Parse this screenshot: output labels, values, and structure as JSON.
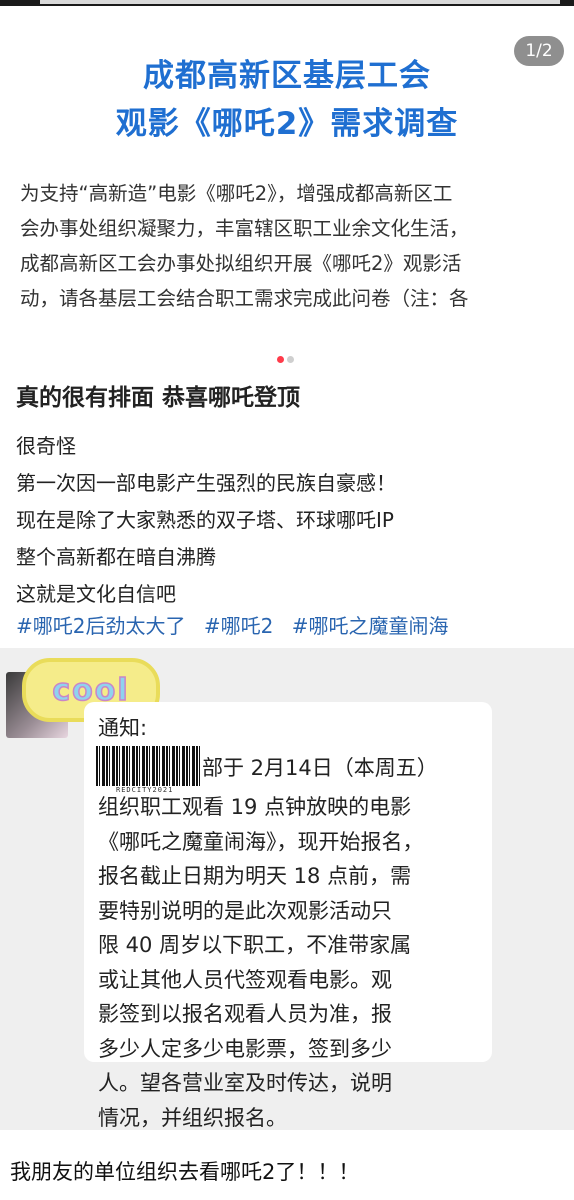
{
  "article": {
    "page_indicator": "1/2",
    "title_line1": "成都高新区基层工会",
    "title_line2": "观影《哪吒2》需求调查",
    "intro_lines": [
      "为支持“高新造”电影《哪吒2》，增强成都高新区工",
      "会办事处组织凝聚力，丰富辖区职工业余文化生活，",
      "成都高新区工会办事处拟组织开展《哪吒2》观影活",
      "动，请各基层工会结合职工需求完成此问卷（注：各"
    ]
  },
  "post": {
    "title": "真的很有排面 恭喜哪吒登顶",
    "lines": [
      "很奇怪",
      "第一次因一部电影产生强烈的民族自豪感！",
      "现在是除了大家熟悉的双子塔、环球哪吒IP",
      "整个高新都在暗自沸腾",
      "这就是文化自信吧"
    ],
    "hashtags": [
      "#哪吒2后劲太大了",
      "#哪吒2",
      "#哪吒之魔童闹海"
    ]
  },
  "chat": {
    "sticker_text": "cool",
    "barcode_caption": "REDCITY2021",
    "notice_heading": "通知:",
    "notice_first": "部于 2月14日（本周五）",
    "notice_lines": [
      "组织职工观看 19 点钟放映的电影",
      "《哪吒之魔童闹海》，现开始报名，",
      "报名截止日期为明天 18 点前，需",
      "要特别说明的是此次观影活动只",
      "限 40 周岁以下职工，不准带家属",
      "或让其他人员代签观看电影。观",
      "影签到以报名观看人员为准，报",
      "多少人定多少电影票，签到多少",
      "人。望各营业室及时传达，说明",
      "情况，并组织报名。"
    ]
  },
  "footer": {
    "text": "我朋友的单位组织去看哪吒2了！！！"
  },
  "colors": {
    "title_blue": "#1f6fd1",
    "hashtag_blue": "#2a65b0",
    "dot_active": "#ff3b4a"
  }
}
